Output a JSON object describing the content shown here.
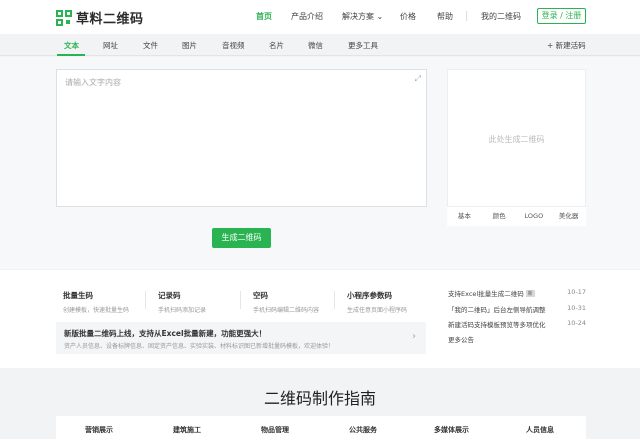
{
  "brand": {
    "name": "草料二维码"
  },
  "nav": {
    "items": [
      "首页",
      "产品介绍",
      "解决方案",
      "价格",
      "帮助"
    ],
    "dropdown_caret": "⌄",
    "my_codes": "我的二维码",
    "login": "登录 / 注册"
  },
  "tabs": [
    "文本",
    "网址",
    "文件",
    "图片",
    "音视频",
    "名片",
    "微信",
    "更多工具"
  ],
  "new_code": "+ 新建活码",
  "editor": {
    "placeholder": "请输入文字内容",
    "expand_icon": "⤢"
  },
  "generate_button": "生成二维码",
  "preview": {
    "placeholder": "此处生成二维码",
    "tabs": [
      "基本",
      "颜色",
      "LOGO",
      "美化器"
    ]
  },
  "features": [
    {
      "title": "批量生码",
      "desc": "创建模板，快速批量生码"
    },
    {
      "title": "记录码",
      "desc": "手机扫码添加记录"
    },
    {
      "title": "空码",
      "desc": "手机扫码编辑二维码内容"
    },
    {
      "title": "小程序参数码",
      "desc": "生成任意页面小程序码"
    }
  ],
  "banner": {
    "title": "新版批量二维码上线，支持从Excel批量新建，功能更强大！",
    "desc": "资产人员信息、设备标牌信息、固定资产信息、实验实装、材料标识图已新增批量码模板，欢迎体验！",
    "arrow": "›"
  },
  "news": [
    {
      "text": "支持Excel批量生成二维码",
      "badge": "新",
      "date": "10-17"
    },
    {
      "text": "「我的二维码」后台左侧导航调整",
      "badge": "",
      "date": "10-31"
    },
    {
      "text": "新建活码支持模板预览等多项优化",
      "badge": "",
      "date": "10-24"
    },
    {
      "text": "更多公告",
      "badge": "",
      "date": ""
    }
  ],
  "guide": {
    "title": "二维码制作指南",
    "categories": [
      "营销展示",
      "建筑施工",
      "物品管理",
      "公共服务",
      "多媒体展示",
      "人员信息"
    ]
  },
  "colors": {
    "accent": "#2ab351"
  }
}
